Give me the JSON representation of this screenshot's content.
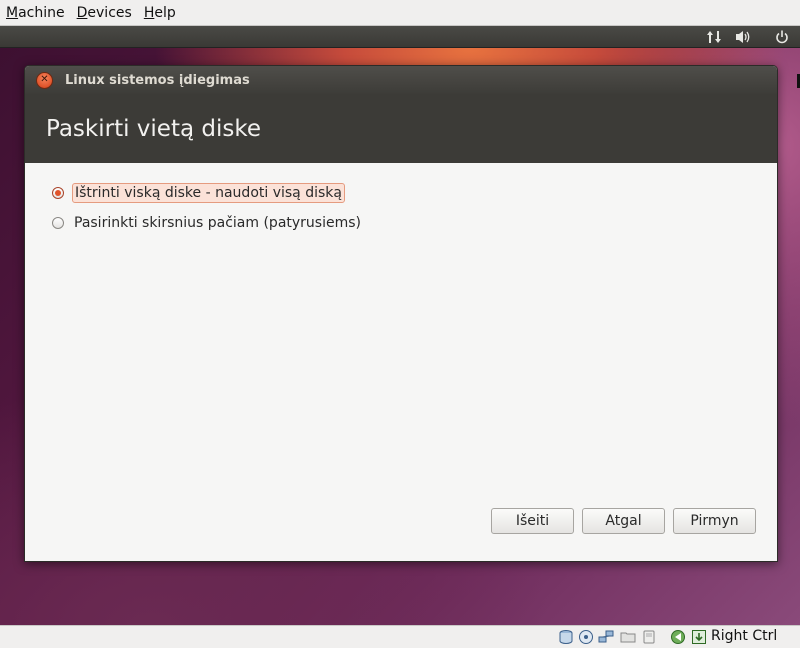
{
  "host_menu": {
    "items": [
      {
        "label_rest": "achine",
        "mnemonic": "M"
      },
      {
        "label_rest": "evices",
        "mnemonic": "D"
      },
      {
        "label_rest": "elp",
        "mnemonic": "H"
      }
    ]
  },
  "guest_panel": {
    "icons": [
      "network-arrows-icon",
      "volume-icon",
      "power-icon"
    ]
  },
  "window": {
    "title": "Linux sistemos įdiegimas",
    "page_title": "Paskirti vietą diske",
    "options": [
      {
        "label": "Ištrinti viską diske - naudoti visą diską",
        "checked": true
      },
      {
        "label": "Pasirinkti skirsnius pačiam (patyrusiems)",
        "checked": false
      }
    ],
    "buttons": {
      "quit": "Išeiti",
      "back": "Atgal",
      "forward": "Pirmyn"
    }
  },
  "statusbar": {
    "hostkey_label": "Right Ctrl",
    "icons": [
      "hard-disk-icon",
      "optical-drive-icon",
      "network-icon",
      "shared-folder-icon",
      "usb-icon",
      "capture-icon",
      "keyboard-capture-icon"
    ]
  },
  "colors": {
    "accent": "#e0532a",
    "header_band": "#3c3b37"
  }
}
